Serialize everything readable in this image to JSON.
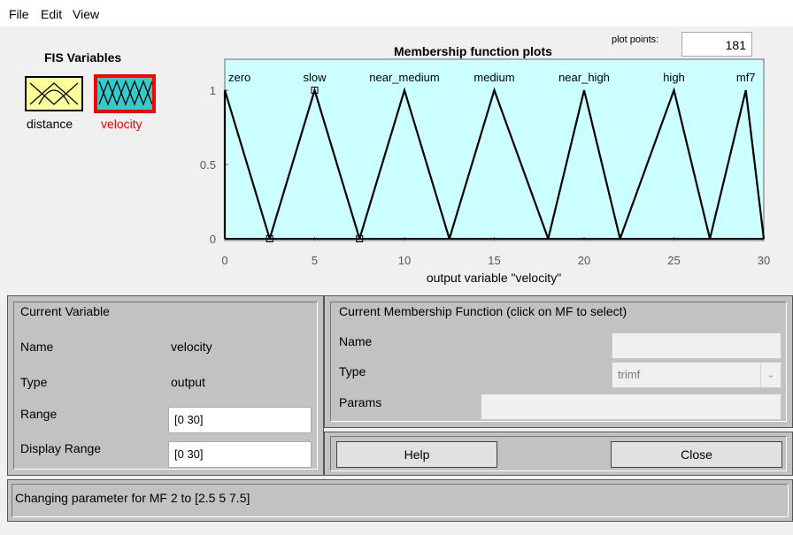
{
  "menu": {
    "file": "File",
    "edit": "Edit",
    "view": "View"
  },
  "fis_variables": {
    "title": "FIS Variables",
    "inputs": [
      {
        "label": "distance"
      }
    ],
    "outputs": [
      {
        "label": "velocity",
        "selected": true
      }
    ]
  },
  "plot": {
    "title": "Membership function plots",
    "plot_points_label": "plot points:",
    "plot_points_value": "181",
    "xlabel": "output variable \"velocity\"",
    "xticks": [
      "0",
      "5",
      "10",
      "15",
      "20",
      "25",
      "30"
    ],
    "yticks": [
      "0",
      "0.5",
      "1"
    ],
    "mf_labels": [
      "zero",
      "slow",
      "near_medium",
      "medium",
      "near_high",
      "high",
      "mf7"
    ],
    "colors": {
      "background": "#ccffff",
      "line": "#000000"
    }
  },
  "chart_data": {
    "type": "line",
    "title": "Membership function plots",
    "xlabel": "output variable \"velocity\"",
    "ylabel": "",
    "xlim": [
      0,
      30
    ],
    "ylim": [
      0,
      1
    ],
    "xticks": [
      0,
      5,
      10,
      15,
      20,
      25,
      30
    ],
    "yticks": [
      0,
      0.5,
      1
    ],
    "series": [
      {
        "name": "zero",
        "x": [
          0,
          0,
          2.5
        ],
        "y": [
          0,
          1,
          0
        ]
      },
      {
        "name": "slow",
        "x": [
          2.5,
          5,
          7.5
        ],
        "y": [
          0,
          1,
          0
        ]
      },
      {
        "name": "near_medium",
        "x": [
          7.5,
          10,
          12.5
        ],
        "y": [
          0,
          1,
          0
        ]
      },
      {
        "name": "medium",
        "x": [
          12.5,
          15,
          18
        ],
        "y": [
          0,
          1,
          0
        ]
      },
      {
        "name": "near_high",
        "x": [
          18,
          20,
          22
        ],
        "y": [
          0,
          1,
          0
        ]
      },
      {
        "name": "high",
        "x": [
          22,
          25,
          27
        ],
        "y": [
          0,
          1,
          0
        ]
      },
      {
        "name": "mf7",
        "x": [
          27,
          29,
          30
        ],
        "y": [
          0,
          1,
          0
        ]
      }
    ],
    "selected_mf": "slow",
    "selected_markers_x": [
      2.5,
      5,
      7.5
    ],
    "selected_markers_y": [
      0,
      1,
      0
    ]
  },
  "current_variable": {
    "title": "Current Variable",
    "name_label": "Name",
    "name_value": "velocity",
    "type_label": "Type",
    "type_value": "output",
    "range_label": "Range",
    "range_value": "[0 30]",
    "display_range_label": "Display Range",
    "display_range_value": "[0 30]"
  },
  "current_mf": {
    "title": "Current Membership Function (click on MF to select)",
    "name_label": "Name",
    "name_value": "",
    "type_label": "Type",
    "type_value": "trimf",
    "params_label": "Params",
    "params_value": ""
  },
  "buttons": {
    "help": "Help",
    "close": "Close"
  },
  "status": "Changing parameter for MF 2 to  [2.5 5 7.5]"
}
